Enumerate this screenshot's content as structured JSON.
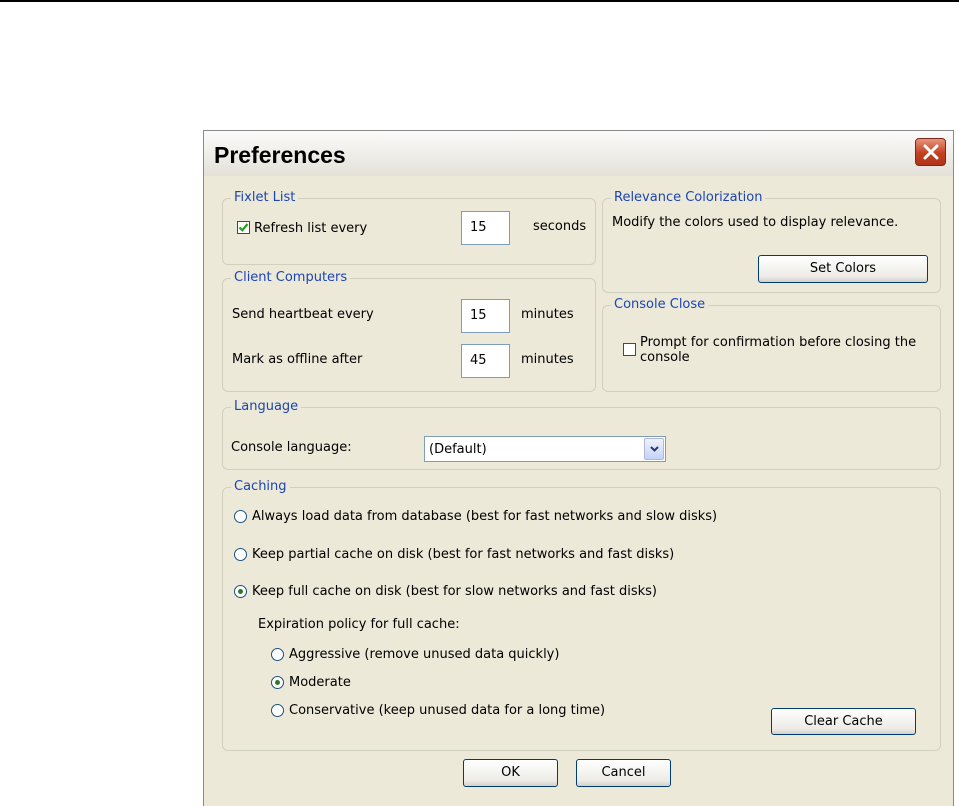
{
  "window": {
    "title": "Preferences"
  },
  "fixlet_list": {
    "legend": "Fixlet List",
    "refresh_label": "Refresh list every",
    "refresh_checked": true,
    "refresh_value": "15",
    "refresh_unit": "seconds"
  },
  "relevance": {
    "legend": "Relevance Colorization",
    "description": "Modify the colors used to display relevance.",
    "button": "Set Colors"
  },
  "client_computers": {
    "legend": "Client Computers",
    "heartbeat_label": "Send heartbeat every",
    "heartbeat_value": "15",
    "heartbeat_unit": "minutes",
    "offline_label": "Mark as offline after",
    "offline_value": "45",
    "offline_unit": "minutes"
  },
  "console_close": {
    "legend": "Console Close",
    "prompt_line1": "Prompt for confirmation before closing the",
    "prompt_line2": "console",
    "prompt_checked": false
  },
  "language": {
    "legend": "Language",
    "label": "Console language:",
    "selected": "(Default)"
  },
  "caching": {
    "legend": "Caching",
    "options": [
      {
        "label": "Always load data from database (best for fast networks and slow disks)",
        "selected": false
      },
      {
        "label": "Keep partial cache on disk (best for fast networks and fast disks)",
        "selected": false
      },
      {
        "label": "Keep full cache on disk (best for slow networks and fast disks)",
        "selected": true
      }
    ],
    "expiration_label": "Expiration policy for full cache:",
    "expiration_options": [
      {
        "label": "Aggressive (remove unused data quickly)",
        "selected": false
      },
      {
        "label": "Moderate",
        "selected": true
      },
      {
        "label": "Conservative (keep unused data for a long time)",
        "selected": false
      }
    ],
    "clear_button": "Clear Cache"
  },
  "footer": {
    "ok": "OK",
    "cancel": "Cancel"
  },
  "icons": {
    "close": "close-icon",
    "check": "check-icon",
    "dropdown": "chevron-down-icon"
  },
  "colors": {
    "legend_text": "#1c45b2",
    "dialog_bg": "#ece9d8",
    "close_button": "#c2401f",
    "check_mark": "#21a121",
    "radio_dot": "#2c7a23"
  }
}
